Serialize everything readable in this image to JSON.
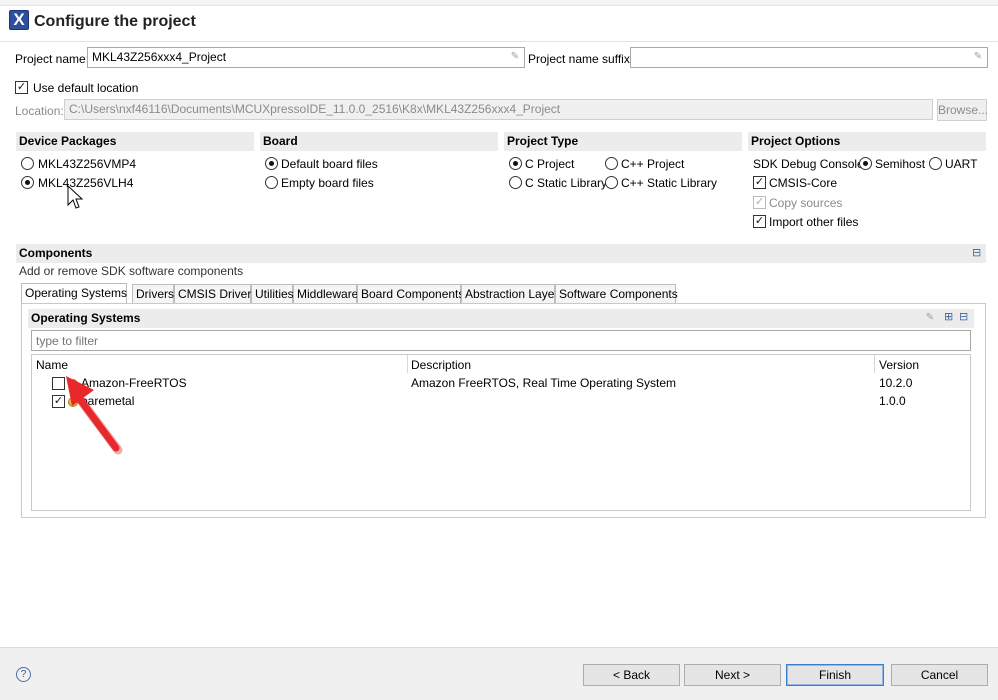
{
  "window": {
    "title": "Configure the project",
    "app_icon_glyph": "X"
  },
  "project": {
    "name_label": "Project name:",
    "name_value": "MKL43Z256xxx4_Project",
    "suffix_label": "Project name suffix:",
    "suffix_value": "",
    "use_default_location_label": "Use default location",
    "use_default_location_checked": true,
    "location_label": "Location:",
    "location_value": "C:\\Users\\nxf46116\\Documents\\MCUXpressoIDE_11.0.0_2516\\K8x\\MKL43Z256xxx4_Project",
    "browse_label": "Browse..."
  },
  "device_packages": {
    "header": "Device Packages",
    "items": [
      {
        "label": "MKL43Z256VMP4",
        "selected": false
      },
      {
        "label": "MKL43Z256VLH4",
        "selected": true
      }
    ]
  },
  "board": {
    "header": "Board",
    "items": [
      {
        "label": "Default board files",
        "selected": true
      },
      {
        "label": "Empty board files",
        "selected": false
      }
    ]
  },
  "project_type": {
    "header": "Project Type",
    "items": [
      {
        "label": "C Project",
        "selected": true
      },
      {
        "label": "C++ Project",
        "selected": false
      },
      {
        "label": "C Static Library",
        "selected": false
      },
      {
        "label": "C++ Static Library",
        "selected": false
      }
    ]
  },
  "project_options": {
    "header": "Project Options",
    "sdk_debug_console_label": "SDK Debug Console",
    "console_options": [
      {
        "label": "Semihost",
        "selected": true
      },
      {
        "label": "UART",
        "selected": false
      }
    ],
    "checks": [
      {
        "label": "CMSIS-Core",
        "checked": true,
        "enabled": true
      },
      {
        "label": "Copy sources",
        "checked": true,
        "enabled": false
      },
      {
        "label": "Import other files",
        "checked": true,
        "enabled": true
      }
    ]
  },
  "components": {
    "header": "Components",
    "description": "Add or remove SDK software components",
    "collapse_glyph": "⊟",
    "tabs": [
      "Operating Systems",
      "Drivers",
      "CMSIS Drivers",
      "Utilities",
      "Middleware",
      "Board Components",
      "Abstraction Layer",
      "Software Components"
    ],
    "active_tab": 0
  },
  "os_panel": {
    "header": "Operating Systems",
    "filter_placeholder": "type to filter",
    "columns": [
      "Name",
      "Description",
      "Version"
    ],
    "rows": [
      {
        "name": "Amazon-FreeRTOS",
        "description": "Amazon FreeRTOS, Real Time Operating System",
        "version": "10.2.0",
        "checked": false
      },
      {
        "name": "baremetal",
        "description": "",
        "version": "1.0.0",
        "checked": true
      }
    ]
  },
  "footer": {
    "help_glyph": "?",
    "back_label": "< Back",
    "next_label": "Next >",
    "finish_label": "Finish",
    "cancel_label": "Cancel"
  },
  "colors": {
    "accent": "#2c4f9e",
    "annotation_arrow": "#e8282b",
    "section_header_bg": "#ececec"
  }
}
